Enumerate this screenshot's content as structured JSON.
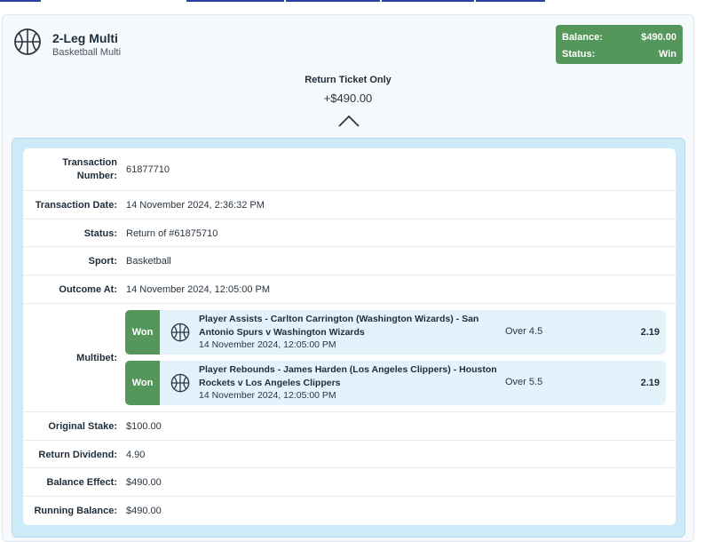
{
  "bet": {
    "title": "2-Leg Multi",
    "subtitle": "Basketball Multi",
    "balance_label": "Balance:",
    "balance_value": "$490.00",
    "status_label": "Status:",
    "status_value": "Win",
    "return_label": "Return Ticket Only",
    "return_amount": "+$490.00"
  },
  "details": {
    "transaction_number": {
      "label": "Transaction Number:",
      "value": "61877710"
    },
    "transaction_date": {
      "label": "Transaction Date:",
      "value": "14 November 2024, 2:36:32 PM"
    },
    "status": {
      "label": "Status:",
      "value": "Return of #61875710"
    },
    "sport": {
      "label": "Sport:",
      "value": "Basketball"
    },
    "outcome_at": {
      "label": "Outcome At:",
      "value": "14 November 2024, 12:05:00 PM"
    },
    "multibet_label": "Multibet:",
    "legs": [
      {
        "result": "Won",
        "title": "Player Assists - Carlton Carrington (Washington Wizards) - San Antonio Spurs v Washington Wizards",
        "time": "14 November 2024, 12:05:00 PM",
        "selection": "Over 4.5",
        "odds": "2.19"
      },
      {
        "result": "Won",
        "title": "Player Rebounds - James Harden (Los Angeles Clippers) - Houston Rockets v Los Angeles Clippers",
        "time": "14 November 2024, 12:05:00 PM",
        "selection": "Over 5.5",
        "odds": "2.19"
      }
    ],
    "original_stake": {
      "label": "Original Stake:",
      "value": "$100.00"
    },
    "return_dividend": {
      "label": "Return Dividend:",
      "value": "4.90"
    },
    "balance_effect": {
      "label": "Balance Effect:",
      "value": "$490.00"
    },
    "running_balance": {
      "label": "Running Balance:",
      "value": "$490.00"
    }
  },
  "icons": {
    "bet_icon": "basketball-icon",
    "expand_icon": "chevron-up-icon",
    "leg_icon": "basketball-icon"
  },
  "colors": {
    "win_green": "#55965a",
    "panel_blue": "#cdeaf8",
    "leg_background": "#e4f2fb"
  }
}
